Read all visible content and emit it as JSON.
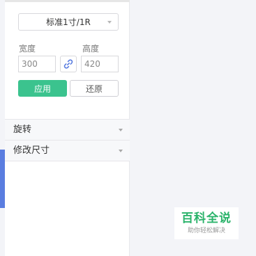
{
  "size_panel": {
    "preset_select": {
      "value": "标准1寸/1R"
    },
    "width": {
      "label": "宽度",
      "value": "300"
    },
    "height": {
      "label": "高度",
      "value": "420"
    },
    "apply_label": "应用",
    "reset_label": "还原"
  },
  "sections": [
    {
      "label": "旋转"
    },
    {
      "label": "修改尺寸"
    }
  ],
  "watermark": {
    "title": "百科全说",
    "subtitle": "助你轻松解决"
  },
  "colors": {
    "accent_green": "#3bc38e",
    "left_accent": "#5a7de0",
    "watermark_green": "#2bb36b"
  },
  "icons": {
    "link": "chain-link-icon",
    "dropdown": "chevron-down-icon"
  }
}
